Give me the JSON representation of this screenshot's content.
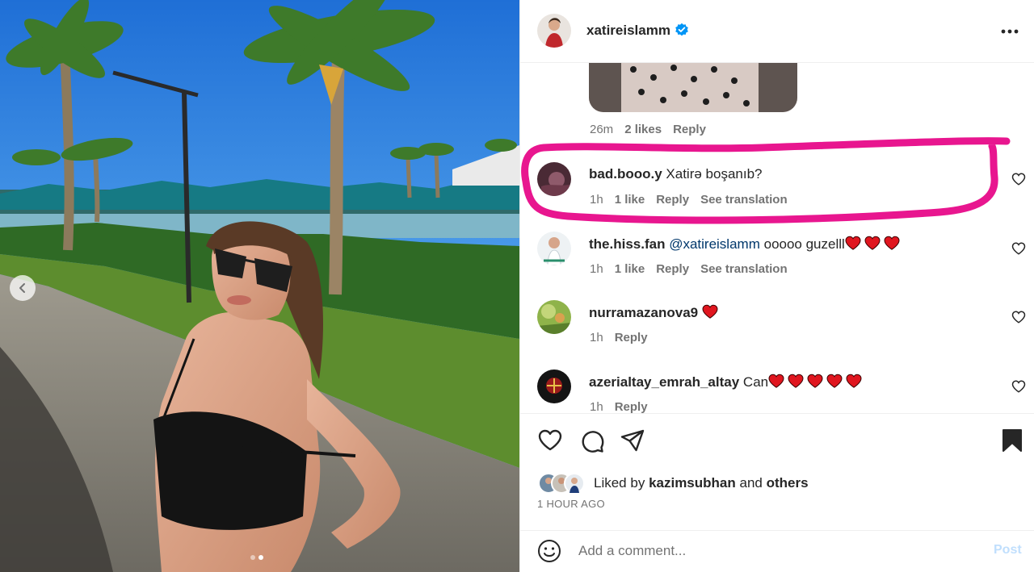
{
  "post": {
    "author": "xatireislamm",
    "verified": true,
    "media_dots": 2,
    "media_active_index": 1
  },
  "reply_preview": {
    "time": "26m",
    "likes": "2 likes",
    "reply": "Reply"
  },
  "comments": [
    {
      "username": "bad.booo.y",
      "text": "Xatirə boşanıb?",
      "time": "1h",
      "likes": "1 like",
      "reply": "Reply",
      "translate": "See translation",
      "highlighted": true
    },
    {
      "username": "the.hiss.fan",
      "mention": "@xatireislamm",
      "text": "ooooo guzelll",
      "hearts": 3,
      "time": "1h",
      "likes": "1 like",
      "reply": "Reply",
      "translate": "See translation"
    },
    {
      "username": "nurramazanova9",
      "hearts": 1,
      "time": "1h",
      "reply": "Reply"
    },
    {
      "username": "azerialtay_emrah_altay",
      "text": "Can",
      "hearts": 5,
      "time": "1h",
      "reply": "Reply"
    }
  ],
  "actions": {
    "icons": [
      "heart-icon",
      "comment-icon",
      "share-icon",
      "bookmark-icon"
    ]
  },
  "likes": {
    "prefix": "Liked by",
    "user": "kazimsubhan",
    "connector": "and",
    "others": "others"
  },
  "timestamp": "1 HOUR AGO",
  "comment_box": {
    "placeholder": "Add a comment...",
    "post_label": "Post"
  },
  "colors": {
    "highlight": "#e8168f",
    "verified": "#0095f6",
    "link": "#00376b",
    "heart_emoji": "#e0161f"
  }
}
